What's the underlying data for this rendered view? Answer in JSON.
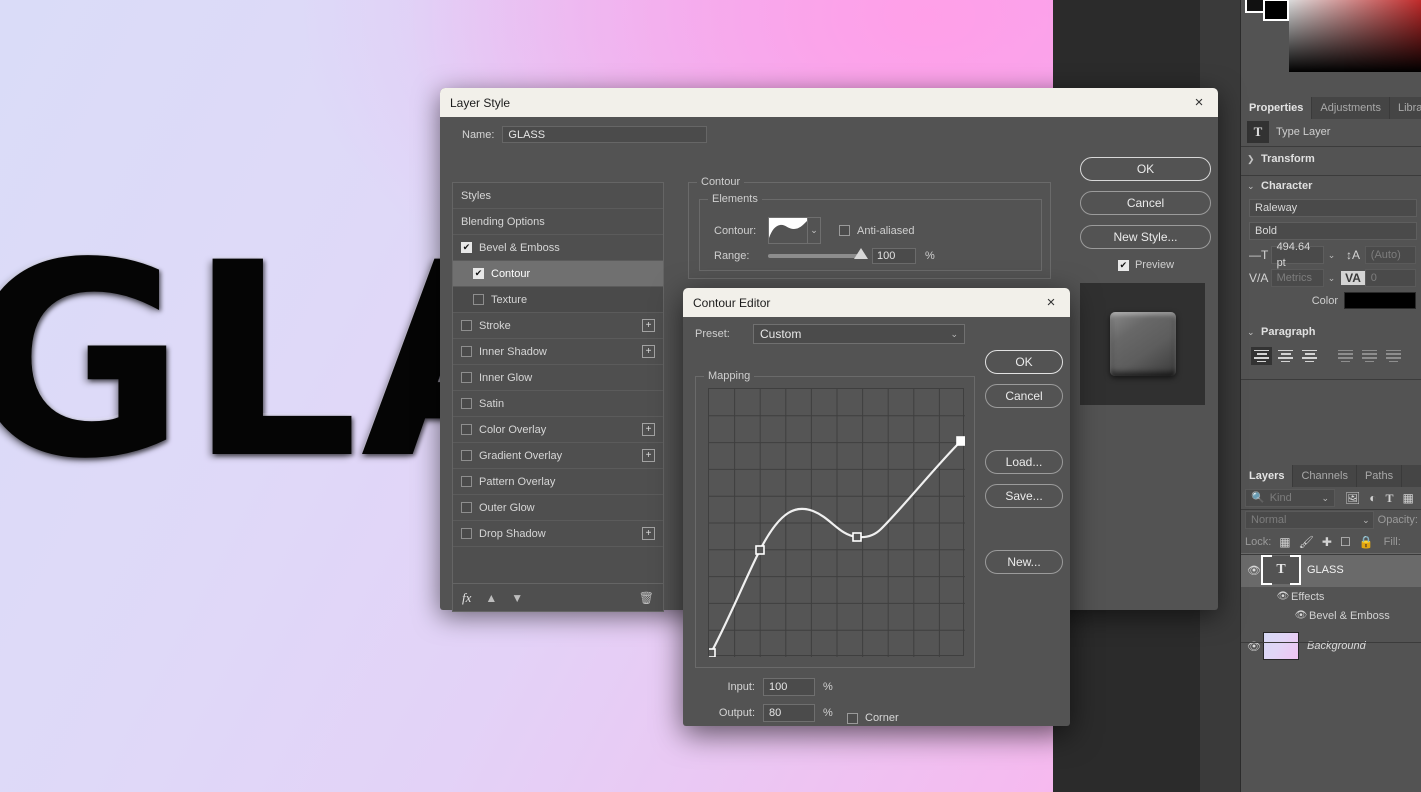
{
  "canvas": {
    "text": "GLA",
    "background_gradient": [
      "#dadcf8",
      "#e3d2f7",
      "#f6b9ef",
      "#ff9fe8"
    ]
  },
  "layer_style_dialog": {
    "title": "Layer Style",
    "close_icon": "×",
    "name_label": "Name:",
    "name_value": "GLASS",
    "effects": [
      {
        "label": "Styles",
        "checkbox": "none",
        "selected": false,
        "sub": false,
        "plus": false
      },
      {
        "label": "Blending Options",
        "checkbox": "none",
        "selected": false,
        "sub": false,
        "plus": false
      },
      {
        "label": "Bevel & Emboss",
        "checkbox": "checked",
        "selected": false,
        "sub": false,
        "plus": false
      },
      {
        "label": "Contour",
        "checkbox": "checked",
        "selected": true,
        "sub": true,
        "plus": false
      },
      {
        "label": "Texture",
        "checkbox": "empty",
        "selected": false,
        "sub": true,
        "plus": false
      },
      {
        "label": "Stroke",
        "checkbox": "empty",
        "selected": false,
        "sub": false,
        "plus": true
      },
      {
        "label": "Inner Shadow",
        "checkbox": "empty",
        "selected": false,
        "sub": false,
        "plus": true
      },
      {
        "label": "Inner Glow",
        "checkbox": "empty",
        "selected": false,
        "sub": false,
        "plus": false
      },
      {
        "label": "Satin",
        "checkbox": "empty",
        "selected": false,
        "sub": false,
        "plus": false
      },
      {
        "label": "Color Overlay",
        "checkbox": "empty",
        "selected": false,
        "sub": false,
        "plus": true
      },
      {
        "label": "Gradient Overlay",
        "checkbox": "empty",
        "selected": false,
        "sub": false,
        "plus": true
      },
      {
        "label": "Pattern Overlay",
        "checkbox": "empty",
        "selected": false,
        "sub": false,
        "plus": false
      },
      {
        "label": "Outer Glow",
        "checkbox": "empty",
        "selected": false,
        "sub": false,
        "plus": false
      },
      {
        "label": "Drop Shadow",
        "checkbox": "empty",
        "selected": false,
        "sub": false,
        "plus": true
      }
    ],
    "footer": {
      "fx_icon": "fx",
      "up_icon": "▲",
      "down_icon": "▼",
      "trash_icon": "🗑"
    },
    "contour_group_title": "Contour",
    "elements_group_title": "Elements",
    "contour_label": "Contour:",
    "antialiased_label": "Anti-aliased",
    "antialiased_checked": false,
    "range_label": "Range:",
    "range_value": "100",
    "range_unit": "%",
    "buttons": {
      "ok": "OK",
      "cancel": "Cancel",
      "new_style": "New Style..."
    },
    "preview_label": "Preview",
    "preview_checked": true
  },
  "contour_editor": {
    "title": "Contour Editor",
    "close_icon": "×",
    "preset_label": "Preset:",
    "preset_value": "Custom",
    "mapping_label": "Mapping",
    "input_label": "Input:",
    "input_value": "100",
    "output_label": "Output:",
    "output_value": "80",
    "unit": "%",
    "corner_label": "Corner",
    "corner_checked": false,
    "buttons": {
      "ok": "OK",
      "cancel": "Cancel",
      "load": "Load...",
      "save": "Save...",
      "new": "New..."
    },
    "curve_points": [
      {
        "input": 0,
        "output": 0
      },
      {
        "input": 20,
        "output": 40
      },
      {
        "input": 64,
        "output": 44
      },
      {
        "input": 100,
        "output": 80
      }
    ]
  },
  "right_dock": {
    "properties_tabs": [
      {
        "label": "Properties",
        "active": true
      },
      {
        "label": "Adjustments",
        "active": false
      },
      {
        "label": "Librar",
        "active": false
      }
    ],
    "layer_kind": "Type Layer",
    "layer_kind_icon": "T",
    "transform_section": "Transform",
    "character_section": "Character",
    "font_family": "Raleway",
    "font_style": "Bold",
    "font_size": "494.64 pt",
    "leading": "(Auto)",
    "kerning": "Metrics",
    "tracking": "0",
    "color_label": "Color",
    "color_value": "#000000",
    "paragraph_section": "Paragraph",
    "layers_tabs": [
      {
        "label": "Layers",
        "active": true
      },
      {
        "label": "Channels",
        "active": false
      },
      {
        "label": "Paths",
        "active": false
      }
    ],
    "filter_placeholder": "Kind",
    "filter_icon": "search-icon",
    "blend_mode": "Normal",
    "opacity_label": "Opacity:",
    "lock_label": "Lock:",
    "fill_label": "Fill:",
    "layers": [
      {
        "name": "GLASS",
        "type": "type",
        "visible": true,
        "selected": true,
        "children": [
          {
            "name": "Effects",
            "visible": true,
            "indent": 1
          },
          {
            "name": "Bevel & Emboss",
            "visible": true,
            "indent": 2
          }
        ]
      },
      {
        "name": "Background",
        "type": "background",
        "visible": true,
        "selected": false,
        "children": []
      }
    ]
  }
}
